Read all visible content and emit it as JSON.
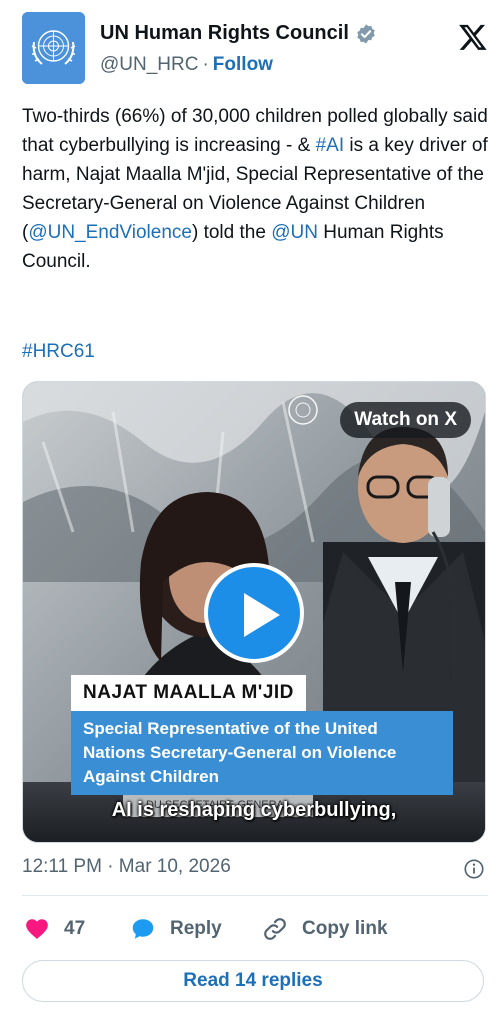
{
  "account": {
    "display_name": "UN Human Rights Council",
    "handle": "@UN_HRC",
    "separator": "·",
    "follow_label": "Follow"
  },
  "tweet": {
    "text_part1": "Two-thirds (66%) of 30,000 children polled globally said that cyberbullying is increasing - & ",
    "hashtag_ai": "#AI",
    "text_part2": " is a key driver of harm, Najat Maalla M'jid, Special Representative of the Secretary-General on Violence Against Children (",
    "mention_endviolence": "@UN_EndViolence",
    "text_part3": ") told the ",
    "mention_un": "@UN",
    "text_part4": " Human Rights Council.",
    "hashtag_hrc": "#HRC61"
  },
  "media": {
    "watch_label": "Watch on X",
    "lower_third_name": "NAJAT MAALLA M'JID",
    "lower_third_title": "Special Representative of the United Nations Secretary-General on Violence Against Children",
    "caption": "AI is reshaping cyberbullying,"
  },
  "meta": {
    "timestamp": "12:11 PM · Mar 10, 2026"
  },
  "actions": {
    "like_count": "47",
    "reply_label": "Reply",
    "copy_label": "Copy link",
    "read_replies_label": "Read 14 replies"
  },
  "colors": {
    "accent": "#1d6fb8",
    "like": "#f91880",
    "reply": "#1d9bf0",
    "un_blue": "#4b92db"
  }
}
